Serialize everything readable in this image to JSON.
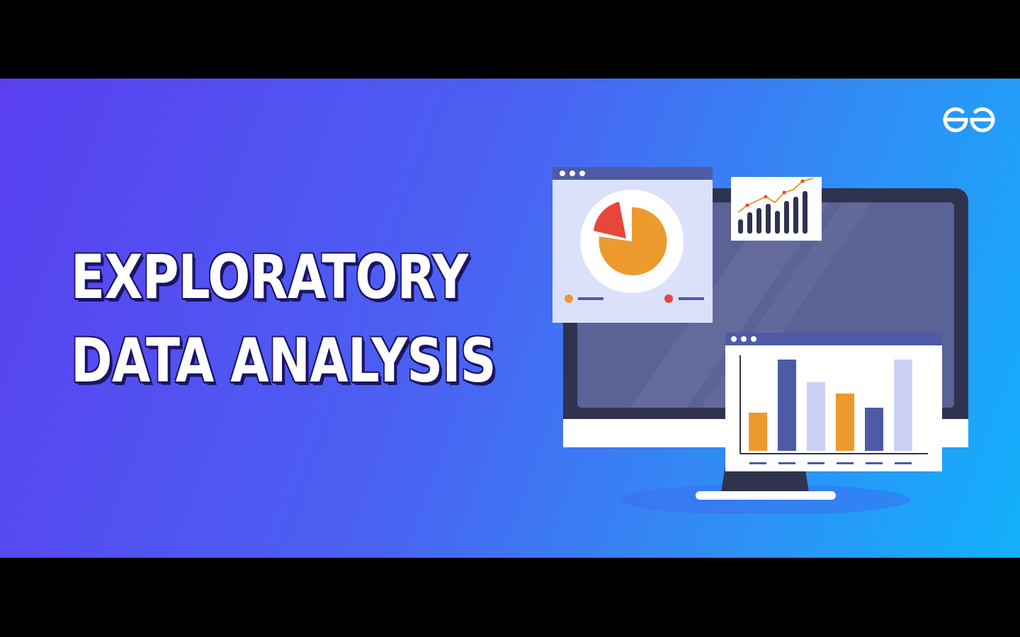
{
  "banner": {
    "title_line1": "EXPLORATORY",
    "title_line2": "DATA ANALYSIS",
    "logo_icon": "gfg-logo-icon",
    "colors": {
      "gradient_start": "#5a3ff0",
      "gradient_end": "#12b0fb",
      "title_text": "#ffffff",
      "title_outline": "#1b1464",
      "orange": "#ec9a2e",
      "red": "#e8453c",
      "navy": "#4e5aa3",
      "lavender": "#c9d0f3",
      "monitor_frame": "#2f3350"
    }
  }
}
